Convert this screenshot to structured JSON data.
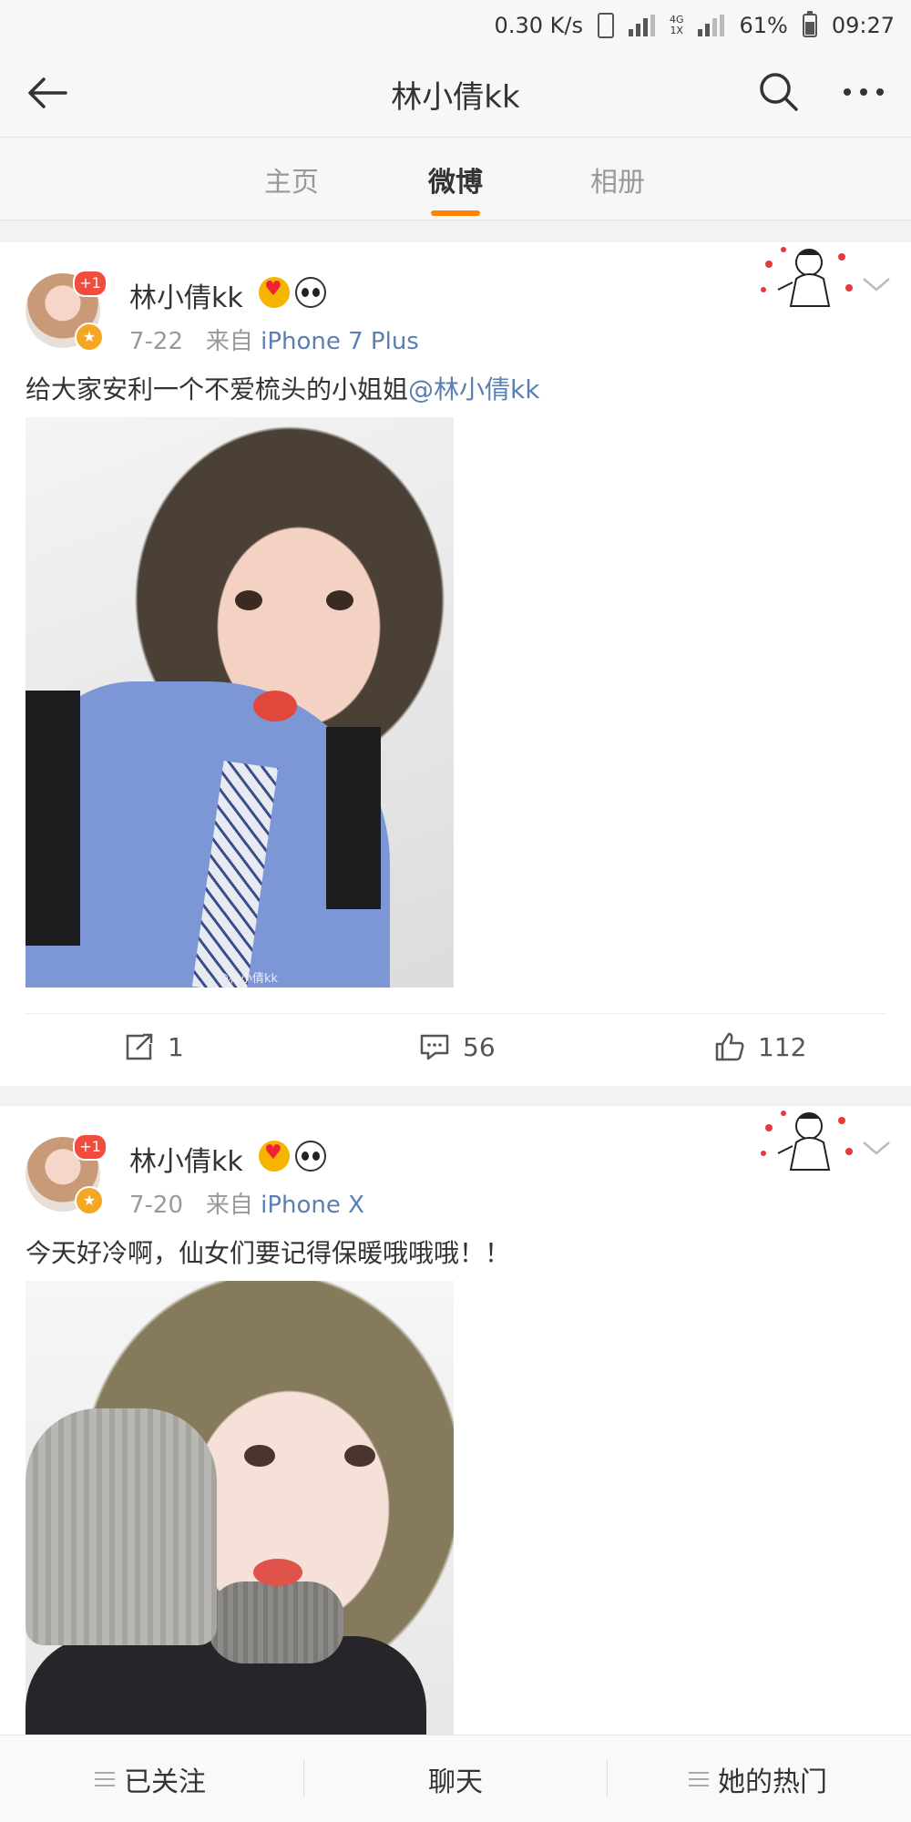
{
  "status_bar": {
    "net_speed": "0.30 K/s",
    "network_top": "4G",
    "network_bottom": "1X",
    "battery": "61%",
    "time": "09:27"
  },
  "nav": {
    "title": "林小倩kk"
  },
  "tabs": [
    {
      "label": "主页",
      "active": false
    },
    {
      "label": "微博",
      "active": true
    },
    {
      "label": "相册",
      "active": false
    }
  ],
  "posts": [
    {
      "author": "林小倩kk",
      "avatar_badge": "+1",
      "date": "7-22",
      "source_prefix": "来自",
      "source": "iPhone 7 Plus",
      "text": "给大家安利一个不爱梳头的小姐姐",
      "mention": "@林小倩kk",
      "image_watermark": "@林小倩kk",
      "reposts": "1",
      "comments": "56",
      "likes": "112"
    },
    {
      "author": "林小倩kk",
      "avatar_badge": "+1",
      "date": "7-20",
      "source_prefix": "来自",
      "source": "iPhone X",
      "text": "今天好冷啊，仙女们要记得保暖哦哦哦！！"
    }
  ],
  "bottom_bar": {
    "follow": "已关注",
    "chat": "聊天",
    "hot": "她的热门"
  },
  "colors": {
    "accent": "#ff8200",
    "link": "#5b7fb3",
    "badge_red": "#f24c3d"
  }
}
